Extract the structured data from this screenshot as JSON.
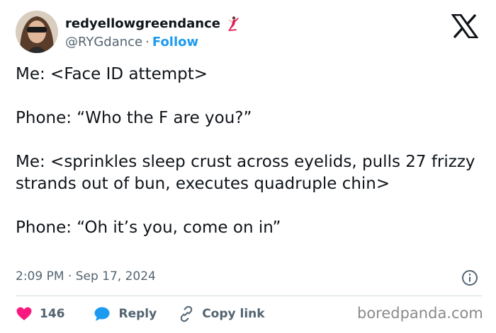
{
  "author": {
    "display_name": "redyellowgreendance",
    "handle": "@RYGdance",
    "separator": "·",
    "follow_label": "Follow"
  },
  "tweet": {
    "paragraphs": [
      "Me: <Face ID attempt>",
      "Phone: “Who the F are you?”",
      "Me: <sprinkles sleep crust across eyelids, pulls 27 frizzy strands out of bun, executes quadruple chin>",
      "Phone: “Oh it’s you, come on in”"
    ],
    "timestamp": "2:09 PM · Sep 17, 2024"
  },
  "actions": {
    "likes_count": "146",
    "reply_label": "Reply",
    "copy_link_label": "Copy link"
  },
  "watermark": "boredpanda.com",
  "colors": {
    "accent": "#1d9bf0",
    "heart": "#f91880",
    "text": "#0f1419",
    "secondary": "#536471",
    "divider": "#cfd9de"
  },
  "icons": [
    "dancer-emoji-icon",
    "x-logo-icon",
    "info-icon",
    "heart-icon",
    "reply-bubble-icon",
    "link-icon"
  ]
}
